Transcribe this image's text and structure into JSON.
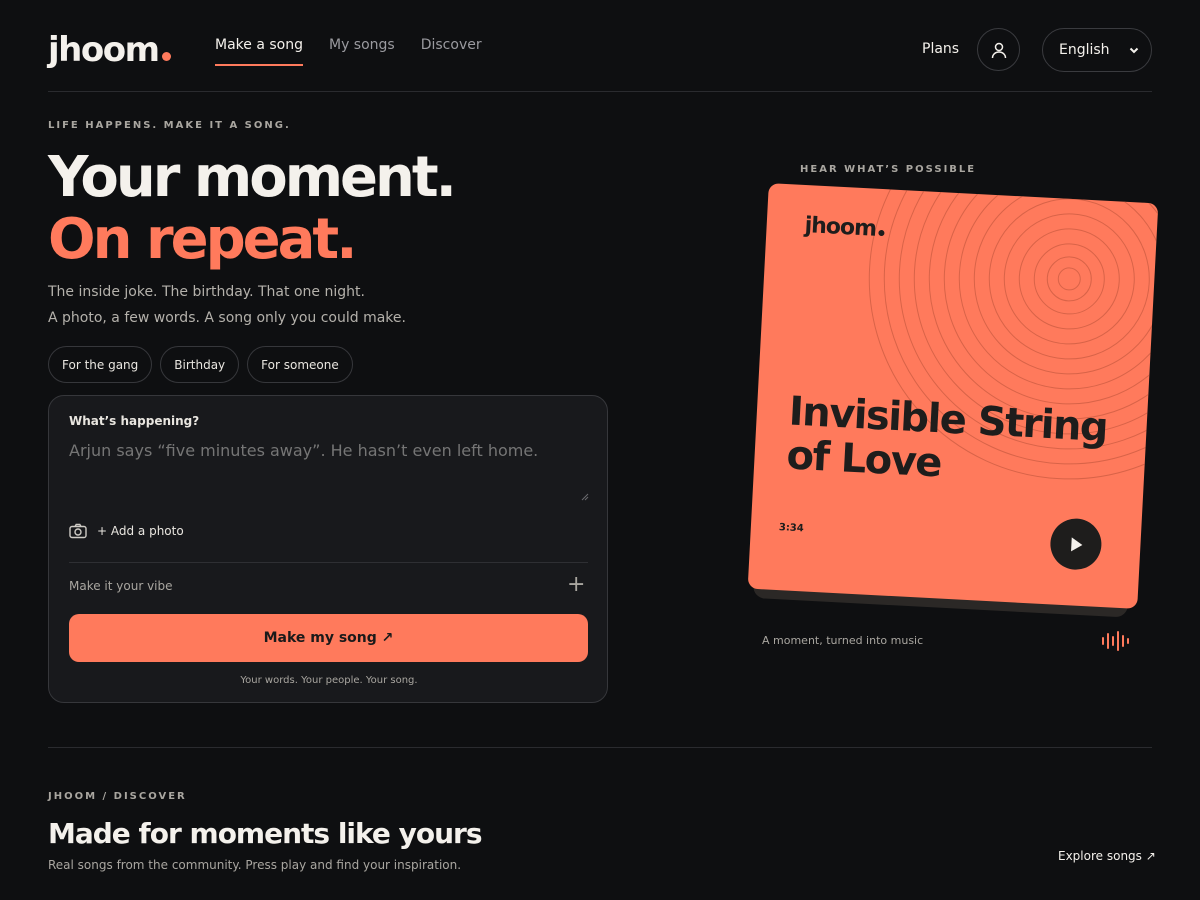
{
  "header": {
    "logo": "jhoom",
    "nav": [
      {
        "label": "Make a song",
        "active": true
      },
      {
        "label": "My songs",
        "active": false
      },
      {
        "label": "Discover",
        "active": false
      }
    ],
    "plans": "Plans",
    "language": "English"
  },
  "hero": {
    "eyebrow": "LIFE HAPPENS. MAKE IT A SONG.",
    "title_line1": "Your moment.",
    "title_line2": "On repeat.",
    "sub_line1": "The inside joke. The birthday. That one night.",
    "sub_line2": "A photo, a few words. A song only you could make.",
    "chips": [
      "For the gang",
      "Birthday",
      "For someone"
    ]
  },
  "composer": {
    "label": "What’s happening?",
    "placeholder": "Arjun says “five minutes away”. He hasn’t even left home.",
    "add_photo": "+ Add a photo",
    "vibe": "Make it your vibe",
    "cta": "Make my song ↗",
    "footnote": "Your words. Your people. Your song."
  },
  "preview": {
    "eyebrow": "HEAR WHAT’S POSSIBLE",
    "card_logo": "jhoom",
    "song_title": "Invisible String of Love",
    "duration": "3:34",
    "caption": "A moment, turned into music"
  },
  "discover": {
    "eyebrow": "JHOOM / DISCOVER",
    "title": "Made for moments like yours",
    "sub": "Real songs from the community. Press play and find your inspiration.",
    "explore": "Explore songs ↗"
  },
  "colors": {
    "accent": "#ff7a5c",
    "background": "#0e0f11",
    "card": "#18191c"
  },
  "icons": [
    "user-icon",
    "chevron-down-icon",
    "camera-icon",
    "plus-icon",
    "play-icon",
    "waveform-icon"
  ]
}
